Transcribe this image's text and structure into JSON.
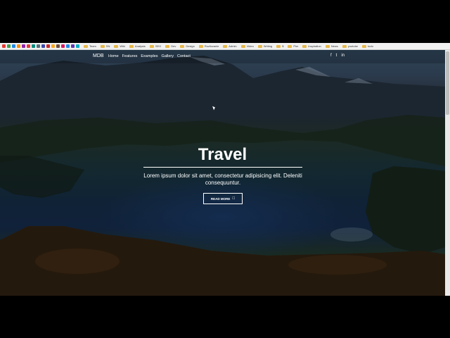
{
  "bookmarks": {
    "favicons": [
      "#e53935",
      "#43a047",
      "#1e88e5",
      "#fb8c00",
      "#8e24aa",
      "#e53935",
      "#00897b",
      "#546e7a",
      "#3949ab",
      "#c62828",
      "#f9a825",
      "#6d4c41",
      "#d81b60",
      "#1e88e5",
      "#5e35b1",
      "#00acc1"
    ],
    "items": [
      "Team",
      "SN",
      "Wiki",
      "Analysis",
      "SEO",
      "Dev",
      "Design",
      "Rozliczanie",
      "Admin",
      "Video",
      "Writing",
      "$",
      "Pim",
      "Inspiration",
      "News",
      "youtube",
      "todo"
    ]
  },
  "nav": {
    "brand": "MDB",
    "links": [
      "Home",
      "Features",
      "Examples",
      "Gallery",
      "Contact"
    ],
    "social": [
      "f",
      "t",
      "in"
    ]
  },
  "hero": {
    "title": "Travel",
    "subtitle": "Lorem ipsum dolor sit amet, consectetur adipisicing elit. Deleniti consequuntur.",
    "button_label": "READ MORE"
  },
  "colors": {
    "bookmarks_bg": "#f1f1f1",
    "hero_text": "#ffffff"
  }
}
